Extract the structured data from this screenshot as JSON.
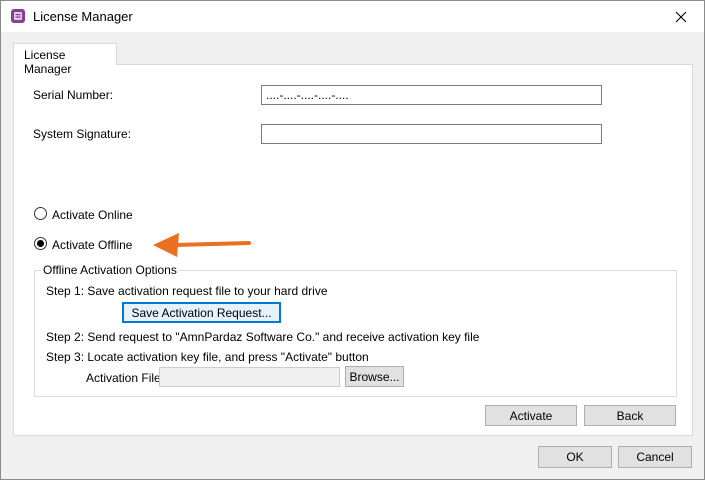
{
  "window": {
    "title": "License Manager",
    "app_icon": "license-manager-icon",
    "close_icon": "close-icon"
  },
  "tabs": [
    {
      "label": "License Manager",
      "active": true
    }
  ],
  "form": {
    "serial_label": "Serial Number:",
    "serial_value": "....-....-....-....-....",
    "signature_label": "System Signature:",
    "signature_value": ""
  },
  "activation": {
    "online_label": "Activate Online",
    "offline_label": "Activate Offline",
    "selected": "offline"
  },
  "offline": {
    "group_title": "Offline Activation Options",
    "step1": "Step 1: Save activation request file to your hard drive",
    "save_button": "Save Activation Request...",
    "step2": "Step 2: Send request to \"AmnPardaz Software Co.\" and receive activation key file",
    "step3": "Step 3: Locate activation key file, and press \"Activate\" button",
    "file_label": "Activation File:",
    "file_value": "",
    "browse_button": "Browse..."
  },
  "actions": {
    "activate": "Activate",
    "back": "Back"
  },
  "dialog_buttons": {
    "ok": "OK",
    "cancel": "Cancel"
  },
  "colors": {
    "annotation_arrow": "#e8701f",
    "focus_border": "#0078d7"
  }
}
